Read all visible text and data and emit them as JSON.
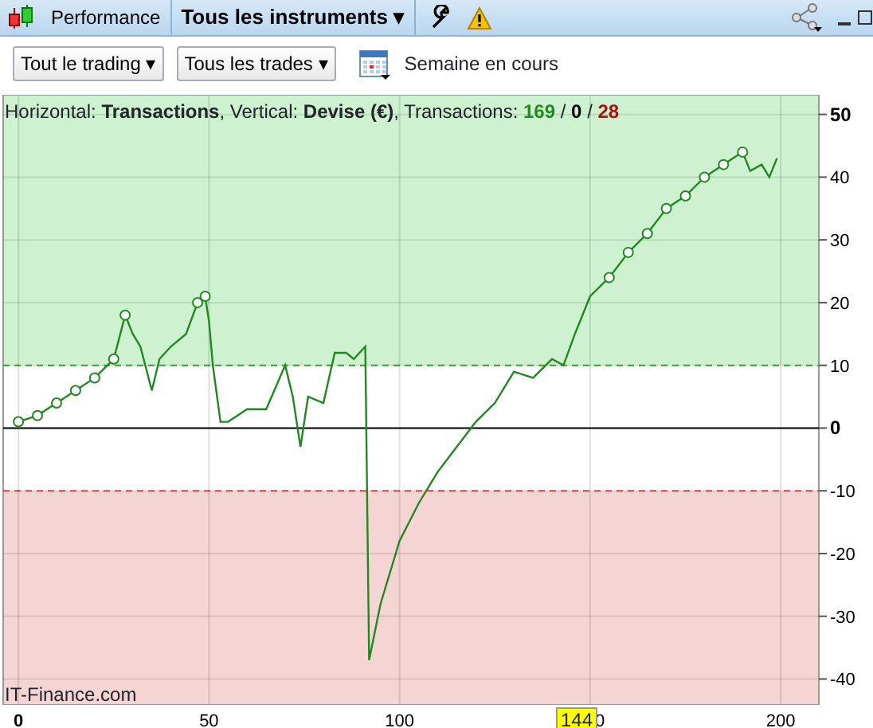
{
  "header": {
    "tabs": [
      {
        "label": "Performance",
        "selected": false,
        "kind": "plain"
      },
      {
        "label": "Tous les instruments",
        "selected": true,
        "kind": "dropdown"
      }
    ],
    "caret": "▾"
  },
  "toolbar": {
    "dropdowns": [
      {
        "label": "Tout le trading"
      },
      {
        "label": "Tous les trades"
      }
    ],
    "caret": "▾",
    "period": "Semaine en cours"
  },
  "info": {
    "text": "Horizontal: **Transactions**, Vertical: **Devise (€)**, Transactions: ",
    "counts": [
      {
        "value": "169",
        "color": "#1e8c1e"
      },
      {
        "value": "0",
        "color": "#000000"
      },
      {
        "value": "28",
        "color": "#b01010"
      }
    ],
    "separator": " / "
  },
  "credit": "IT-Finance.com",
  "cursor_label": "144",
  "chart_data": {
    "type": "line",
    "xlim": [
      -4,
      210
    ],
    "ylim": [
      -44,
      53
    ],
    "xticks": [
      0,
      50,
      100,
      150,
      200
    ],
    "yticks": [
      50,
      40,
      30,
      20,
      10,
      0,
      -10,
      -20,
      -30,
      -40
    ],
    "grid": true,
    "bands": [
      {
        "axis": "y",
        "from": 10,
        "to": 53,
        "color": "#cef2cf"
      },
      {
        "axis": "y",
        "from": -44,
        "to": -10,
        "color": "#f5d5d3"
      }
    ],
    "ref_lines": [
      {
        "axis": "y",
        "value": 10,
        "color": "#3cb43c"
      },
      {
        "axis": "y",
        "value": -10,
        "color": "#e05050"
      }
    ],
    "series": [
      {
        "color": "#1f8a1f",
        "x": [
          0,
          5,
          10,
          15,
          20,
          25,
          28,
          30,
          32,
          35,
          37,
          40,
          44,
          47,
          49,
          50,
          51,
          53,
          55,
          60,
          65,
          70,
          72,
          74,
          76,
          80,
          83,
          86,
          88,
          91,
          92,
          95,
          100,
          105,
          110,
          115,
          120,
          125,
          130,
          135,
          140,
          143,
          146,
          150,
          155,
          160,
          165,
          170,
          175,
          180,
          185,
          190,
          192,
          195,
          197,
          199
        ],
        "values": [
          1,
          2,
          4,
          6,
          8,
          11,
          18,
          15,
          13,
          6,
          11,
          13,
          15,
          20,
          21,
          17,
          10,
          1,
          1,
          3,
          3,
          10,
          5,
          -3,
          5,
          4,
          12,
          12,
          11,
          13,
          -37,
          -28,
          -18,
          -12,
          -7,
          -3,
          1,
          4,
          9,
          8,
          11,
          10,
          15,
          21,
          24,
          28,
          31,
          35,
          37,
          40,
          42,
          44,
          41,
          42,
          40,
          43
        ]
      }
    ]
  }
}
